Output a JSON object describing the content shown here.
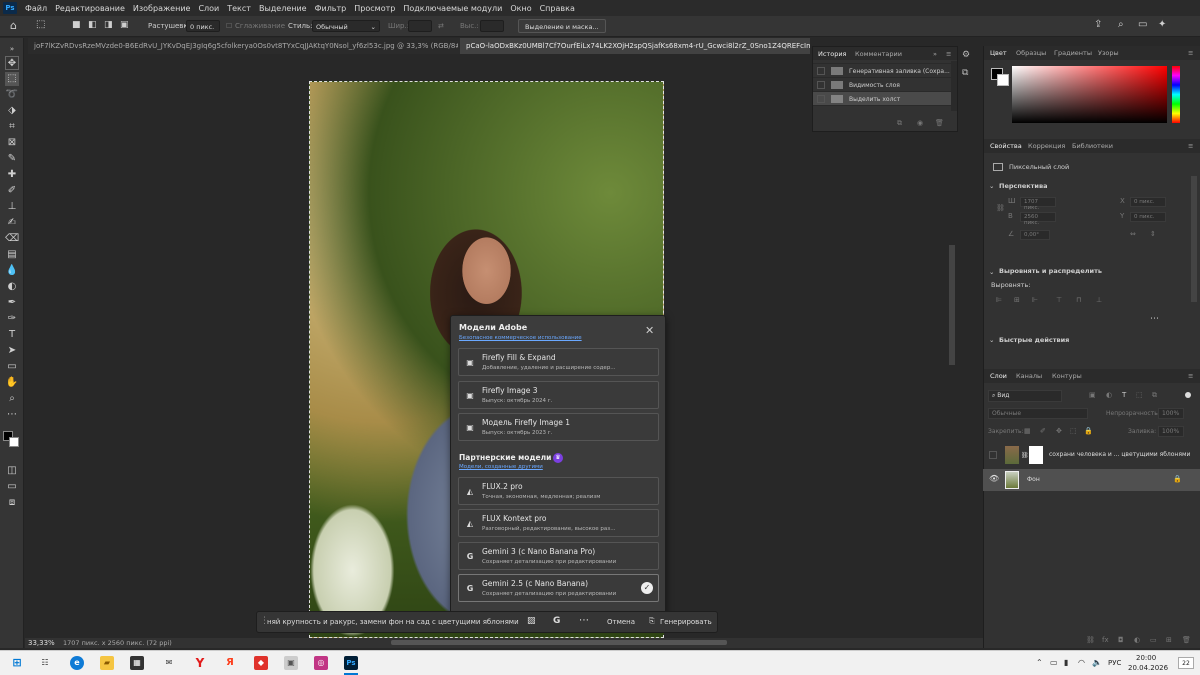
{
  "app": {
    "logo": "Ps"
  },
  "menu": [
    "Файл",
    "Редактирование",
    "Изображение",
    "Слои",
    "Текст",
    "Выделение",
    "Фильтр",
    "Просмотр",
    "Подключаемые модули",
    "Окно",
    "Справка"
  ],
  "options": {
    "feather_label": "Растушевка:",
    "feather_value": "0 пикс.",
    "smoothing_label": "Сглаживание",
    "style_label": "Стиль:",
    "style_value": "Обычный",
    "width_label": "Шир.:",
    "height_label": "Выс.:",
    "mask_button": "Выделение и маска..."
  },
  "tabs": [
    {
      "label": "joF7lKZvRDvsRzeMVzde0-B6EdRvU_JYKvDqEJ3gIq6g5cfolkerya0Os0vt8TYxCqJJAKtqY0Nsol_yf6zl53c.jpg @ 33,3% (RGB/8#) *"
    },
    {
      "label": "pCaO-laODxBKz0UMBl7Cf7OurfEiLx74LK2XOjH2spQSjafKs68xm4-rU_Gcwci8l2rZ_0Sno1Z4QREFcImJPp-4 (1"
    }
  ],
  "history": {
    "tab_active": "История",
    "tab_other": "Комментарии",
    "items": [
      "Выделить холст",
      "Генеративная заливка (Сохра...",
      "Видимость слоя",
      "Выделить холст"
    ]
  },
  "color": {
    "tabs": [
      "Цвет",
      "Образцы",
      "Градиенты",
      "Узоры"
    ],
    "fg": "#000000",
    "bg": "#ffffff"
  },
  "properties": {
    "tabs": [
      "Свойства",
      "Коррекция",
      "Библиотеки"
    ],
    "layer_type": "Пиксельный слой",
    "perspective": "Перспектива",
    "w_value": "1707 пикс.",
    "h_value": "2560 пикс.",
    "x_value": "0 пикс.",
    "y_value": "0 пикс.",
    "angle_value": "0,00°",
    "align_title": "Выровнять и распределить",
    "align_label": "Выровнять:",
    "quick_actions": "Быстрые действия"
  },
  "layers": {
    "tabs": [
      "Слои",
      "Каналы",
      "Контуры"
    ],
    "search": "Вид",
    "blend": "Обычные",
    "opacity_label": "Непрозрачность:",
    "opacity_value": "100%",
    "lock_label": "Закрепить:",
    "fill_label": "Заливка:",
    "fill_value": "100%",
    "rows": [
      {
        "name": "сохрани человека и ... цветущими яблонями"
      },
      {
        "name": "Фон"
      }
    ]
  },
  "modal": {
    "title": "Модели Adobe",
    "adobe_link": "Безопасное коммерческое использование",
    "adobe_models": [
      {
        "name": "Firefly Fill & Expand",
        "desc": "Добавление, удаление и расширение содер..."
      },
      {
        "name": "Firefly Image 3",
        "desc": "Выпуск: октябрь 2024 г."
      },
      {
        "name": "Модель Firefly Image 1",
        "desc": "Выпуск: октябрь 2023 г."
      }
    ],
    "partner_title": "Партнерские модели",
    "partner_link": "Модели, созданные другими",
    "partner_models": [
      {
        "name": "FLUX.2 pro",
        "desc": "Точная, экономная, медленная; реализм"
      },
      {
        "name": "FLUX Kontext pro",
        "desc": "Разговорный, редактирование, высокое раз..."
      },
      {
        "name": "Gemini 3 (с Nano Banana Pro)",
        "desc": "Сохраняет детализацию при редактировании"
      },
      {
        "name": "Gemini 2.5 (с Nano Banana)",
        "desc": "Сохраняет детализацию при редактировании"
      }
    ]
  },
  "genbar": {
    "prompt": "няй крупность и ракурс, замени фон на сад с цветущими яблонями",
    "cancel": "Отмена",
    "generate": "Генерировать"
  },
  "status": {
    "zoom": "33,33%",
    "size": "1707 пикс. x 2560 пикс. (72 ppi)"
  },
  "taskbar": {
    "lang": "РУС",
    "time": "20:00",
    "date": "20.04.2026",
    "notif": "22"
  }
}
